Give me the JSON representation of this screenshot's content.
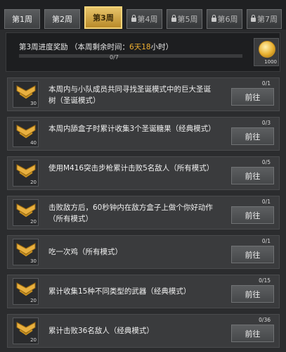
{
  "tabs": [
    {
      "label": "第1周",
      "locked": false
    },
    {
      "label": "第2周",
      "locked": false
    },
    {
      "label": "第3周",
      "locked": false,
      "active": true
    },
    {
      "label": "第4周",
      "locked": true
    },
    {
      "label": "第5周",
      "locked": true
    },
    {
      "label": "第6周",
      "locked": true
    },
    {
      "label": "第7周",
      "locked": true
    }
  ],
  "progress": {
    "title_prefix": "第3周进度奖励 （本周剩余时间：",
    "time_days": "6天",
    "time_hours": "18",
    "time_suffix": "小时）",
    "count": "0/7",
    "fraction": 0.0,
    "reward_count": "1000"
  },
  "tasks": [
    {
      "text": "本周内与小队成员共同寻找圣诞模式中的巨大圣诞树（圣诞模式）",
      "count": "0/1",
      "badge": "30",
      "button": "前往"
    },
    {
      "text": "本周内舔盒子时累计收集3个圣诞糖果（经典模式）",
      "count": "0/3",
      "badge": "40",
      "button": "前往"
    },
    {
      "text": "使用M416突击步枪累计击败5名敌人（所有模式）",
      "count": "0/5",
      "badge": "20",
      "button": "前往"
    },
    {
      "text": "击败敌方后，60秒钟内在敌方盒子上做个你好动作（所有模式）",
      "count": "0/1",
      "badge": "20",
      "button": "前往"
    },
    {
      "text": "吃一次鸡（所有模式）",
      "count": "0/1",
      "badge": "30",
      "button": "前往"
    },
    {
      "text": "累计收集15种不同类型的武器（经典模式）",
      "count": "0/15",
      "badge": "20",
      "button": "前往"
    },
    {
      "text": "累计击败36名敌人（经典模式）",
      "count": "0/36",
      "badge": "20",
      "button": "前往"
    }
  ],
  "colors": {
    "accent": "#e8b040",
    "highlight": "#f0b030"
  }
}
